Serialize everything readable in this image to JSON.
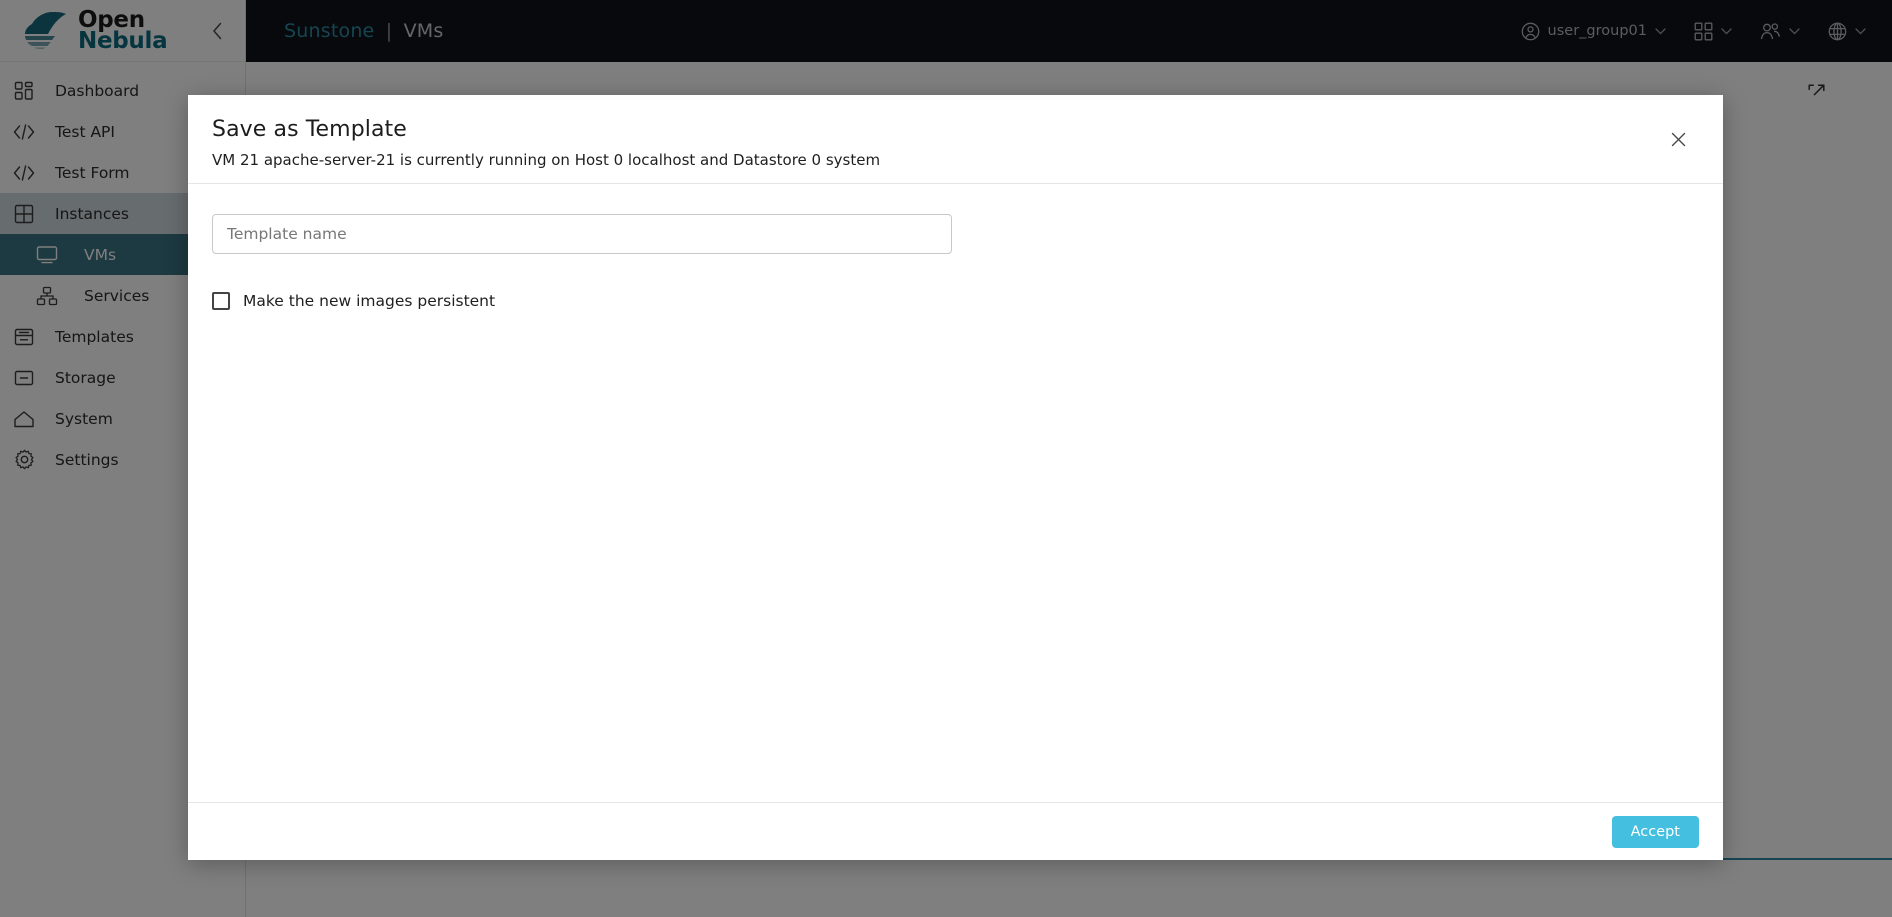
{
  "brand": {
    "logo_open": "Open",
    "logo_nebula": "Nebula",
    "collapse_icon": "chevron-left-icon"
  },
  "sidebar": {
    "items": [
      {
        "label": "Dashboard",
        "icon": "dashboard-icon",
        "state": "normal"
      },
      {
        "label": "Test API",
        "icon": "code-icon",
        "state": "normal"
      },
      {
        "label": "Test Form",
        "icon": "code-icon",
        "state": "normal"
      },
      {
        "label": "Instances",
        "icon": "grid-icon",
        "state": "group-active"
      },
      {
        "label": "VMs",
        "icon": "monitor-icon",
        "state": "selected-sub"
      },
      {
        "label": "Services",
        "icon": "services-icon",
        "state": "sub"
      },
      {
        "label": "Templates",
        "icon": "templates-icon",
        "state": "normal"
      },
      {
        "label": "Storage",
        "icon": "storage-icon",
        "state": "normal"
      },
      {
        "label": "System",
        "icon": "home-icon",
        "state": "normal"
      },
      {
        "label": "Settings",
        "icon": "gear-icon",
        "state": "normal"
      }
    ]
  },
  "topbar": {
    "brand_main": "Sunstone",
    "separator": "|",
    "brand_sub": "VMs",
    "user": {
      "label": "user_group01",
      "icon": "user-circle-icon",
      "chevron": "chevron-down-icon"
    },
    "apps": {
      "icon": "apps-grid-icon",
      "chevron": "chevron-down-icon"
    },
    "groups": {
      "icon": "people-icon",
      "chevron": "chevron-down-icon"
    },
    "language": {
      "icon": "globe-icon",
      "chevron": "chevron-down-icon"
    }
  },
  "page": {
    "expand_icon": "external-link-icon"
  },
  "modal": {
    "title": "Save as Template",
    "subtitle": "VM 21 apache-server-21 is currently running on Host 0 localhost and Datastore 0 system",
    "close_icon": "close-icon",
    "template_name": {
      "placeholder": "Template name",
      "value": ""
    },
    "persistent_checkbox": {
      "label": "Make the new images persistent",
      "checked": false
    },
    "accept_label": "Accept"
  },
  "colors": {
    "accent_teal": "#2d8ba3",
    "accept_blue": "#45bfe0",
    "sidebar_selected": "#3a7383",
    "sidebar_group": "#cfd9dd",
    "topbar_bg": "#10131a"
  }
}
